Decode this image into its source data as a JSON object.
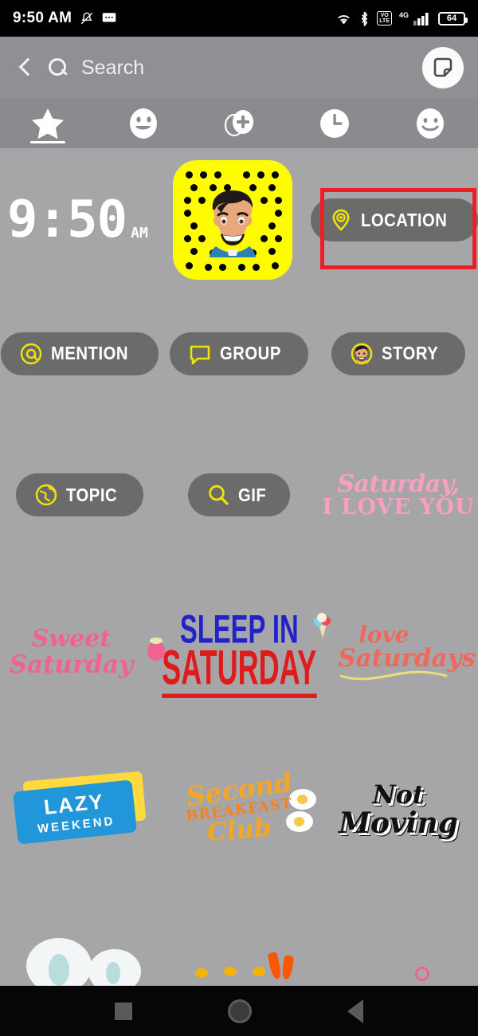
{
  "status_bar": {
    "time": "9:50 AM",
    "battery_percent": "64",
    "network_label": "4G",
    "volte_label_top": "VO",
    "volte_label_bottom": "LTE",
    "icons": [
      "mute-icon",
      "message-icon",
      "wifi-icon",
      "bluetooth-icon",
      "volte-icon",
      "signal-icon",
      "battery-icon"
    ]
  },
  "header": {
    "back_label": "back",
    "search_placeholder": "Search",
    "sticker_button_label": "sticker-note"
  },
  "tabs": [
    {
      "id": "favorites",
      "icon": "star-icon",
      "selected": true
    },
    {
      "id": "emoji",
      "icon": "emoji-face-icon",
      "selected": false
    },
    {
      "id": "create-bitmoji",
      "icon": "bitmoji-plus-icon",
      "selected": false
    },
    {
      "id": "recent",
      "icon": "clock-icon",
      "selected": false
    },
    {
      "id": "smiley",
      "icon": "smiley-icon",
      "selected": false
    }
  ],
  "stickers": {
    "clock": {
      "digits": "9:50",
      "ampm": "AM",
      "name": "time-sticker"
    },
    "snapcode": {
      "name": "snapcode-sticker"
    },
    "buttons": [
      {
        "label": "LOCATION",
        "icon": "location-pin-icon",
        "accent": "#f0e400",
        "highlighted": true
      },
      {
        "label": "MENTION",
        "icon": "at-sign-icon",
        "accent": "#f0e400",
        "highlighted": false
      },
      {
        "label": "GROUP",
        "icon": "chat-bubble-icon",
        "accent": "#f0e400",
        "highlighted": false
      },
      {
        "label": "STORY",
        "icon": "bitmoji-story-icon",
        "accent": "#f0e400",
        "highlighted": false
      },
      {
        "label": "TOPIC",
        "icon": "globe-icon",
        "accent": "#f0e400",
        "highlighted": false
      },
      {
        "label": "GIF",
        "icon": "magnifier-icon",
        "accent": "#f0e400",
        "highlighted": false
      }
    ],
    "art": {
      "saturday_love": {
        "line1": "Saturday,",
        "line2": "I LOVE YOU",
        "color": "#f9a0c0"
      },
      "sweet_saturday": {
        "line1": "Sweet",
        "line2": "Saturday",
        "color": "#f06292"
      },
      "sleep_in": {
        "line1": "SLEEP IN",
        "line2": "SATURDAY",
        "color1": "#2222cc",
        "color2": "#e01b1b"
      },
      "love_saturdays": {
        "line1": "love",
        "line2": "Saturdays",
        "color": "#f0685a"
      },
      "lazy_weekend": {
        "line1": "LAZY",
        "line2": "WEEKEND",
        "color": "#2196d9"
      },
      "second_breakfast": {
        "line1": "Second",
        "line2": "BREAKFAST",
        "line3": "Club",
        "color": "#f5a623"
      },
      "not_moving": {
        "line1": "Not",
        "line2": "Moving",
        "color": "#111111"
      }
    }
  },
  "highlight": {
    "color": "#ee1c25",
    "target": "LOCATION"
  },
  "navbar": {
    "recents_label": "recents",
    "home_label": "home",
    "back_label": "back"
  }
}
